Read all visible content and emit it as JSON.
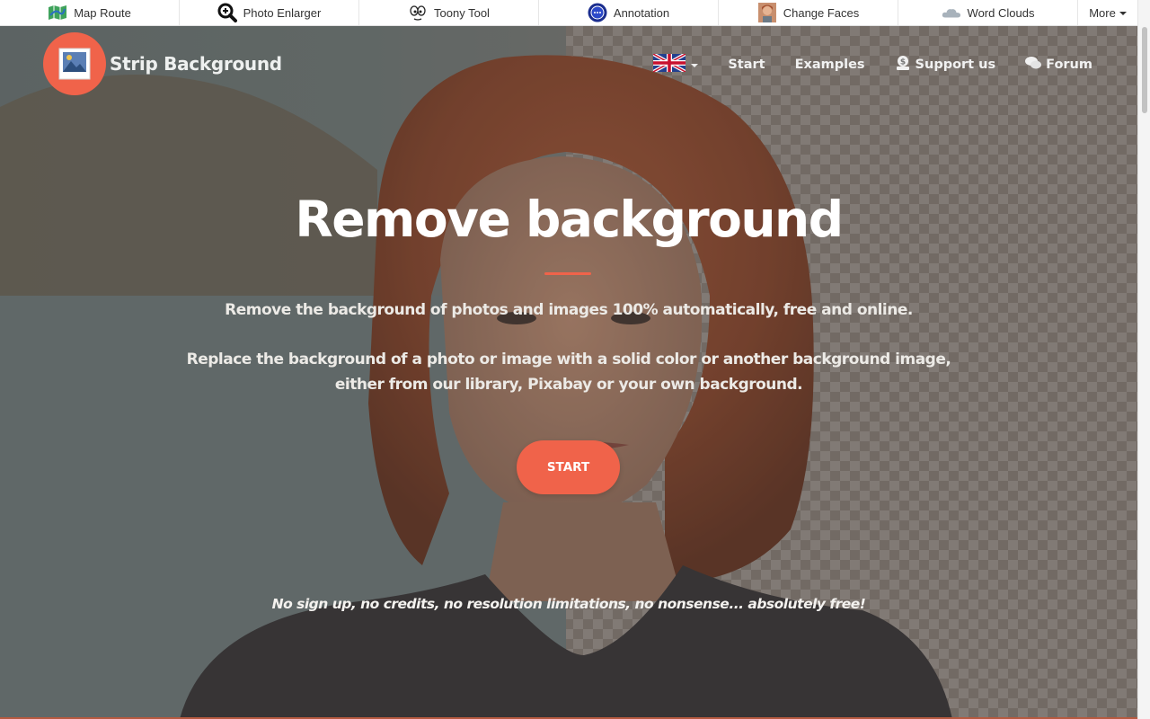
{
  "toolbar": {
    "items": [
      {
        "label": "Map Route",
        "icon": "map-icon"
      },
      {
        "label": "Photo Enlarger",
        "icon": "magnifier-icon"
      },
      {
        "label": "Toony Tool",
        "icon": "cartoon-face-icon"
      },
      {
        "label": "Annotation",
        "icon": "annotation-icon"
      },
      {
        "label": "Change Faces",
        "icon": "face-photo-icon"
      },
      {
        "label": "Word Clouds",
        "icon": "cloud-icon"
      }
    ],
    "more_label": "More"
  },
  "site": {
    "brand": "Strip Background",
    "brand_color": "#f0634a"
  },
  "nav": {
    "language_icon": "uk-flag-icon",
    "items": [
      {
        "label": "Start"
      },
      {
        "label": "Examples"
      },
      {
        "label": "Support us",
        "icon": "donate-icon"
      },
      {
        "label": "Forum",
        "icon": "chat-icon"
      }
    ]
  },
  "hero": {
    "title": "Remove background",
    "lead1": "Remove the background of photos and images 100% automatically, free and online.",
    "lead2": "Replace the background of a photo or image with a solid color or another background image, either from our library, Pixabay or your own background.",
    "cta": "START",
    "tagline": "No sign up, no credits, no resolution limitations, no nonsense... absolutely free!"
  }
}
